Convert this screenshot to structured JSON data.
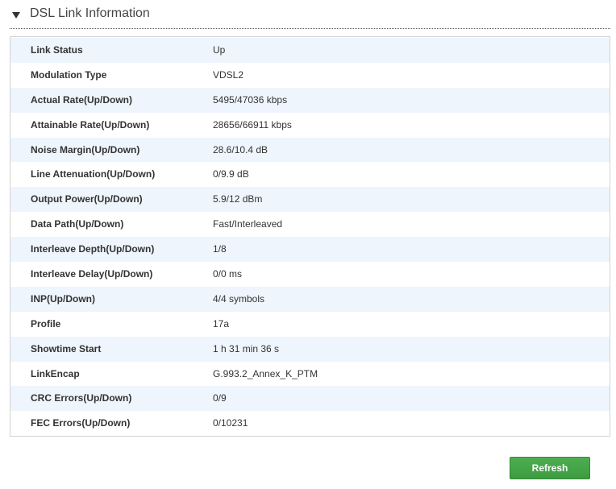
{
  "section": {
    "title": "DSL Link Information",
    "toggle_icon": "triangle-down-icon"
  },
  "rows": [
    {
      "label": "Link Status",
      "value": "Up"
    },
    {
      "label": "Modulation Type",
      "value": "VDSL2"
    },
    {
      "label": "Actual Rate(Up/Down)",
      "value": "5495/47036 kbps"
    },
    {
      "label": "Attainable Rate(Up/Down)",
      "value": "28656/66911 kbps"
    },
    {
      "label": "Noise Margin(Up/Down)",
      "value": "28.6/10.4 dB"
    },
    {
      "label": "Line Attenuation(Up/Down)",
      "value": "0/9.9 dB"
    },
    {
      "label": "Output Power(Up/Down)",
      "value": "5.9/12 dBm"
    },
    {
      "label": "Data Path(Up/Down)",
      "value": "Fast/Interleaved"
    },
    {
      "label": "Interleave Depth(Up/Down)",
      "value": "1/8"
    },
    {
      "label": "Interleave Delay(Up/Down)",
      "value": "0/0 ms"
    },
    {
      "label": "INP(Up/Down)",
      "value": "4/4 symbols"
    },
    {
      "label": "Profile",
      "value": "17a"
    },
    {
      "label": "Showtime Start",
      "value": "1 h 31 min 36 s"
    },
    {
      "label": "LinkEncap",
      "value": "G.993.2_Annex_K_PTM"
    },
    {
      "label": "CRC Errors(Up/Down)",
      "value": "0/9"
    },
    {
      "label": "FEC Errors(Up/Down)",
      "value": "0/10231"
    }
  ],
  "actions": {
    "refresh_label": "Refresh"
  },
  "colors": {
    "row_alt": "#eef5fc",
    "button": "#43a047",
    "divider": "#555555"
  }
}
